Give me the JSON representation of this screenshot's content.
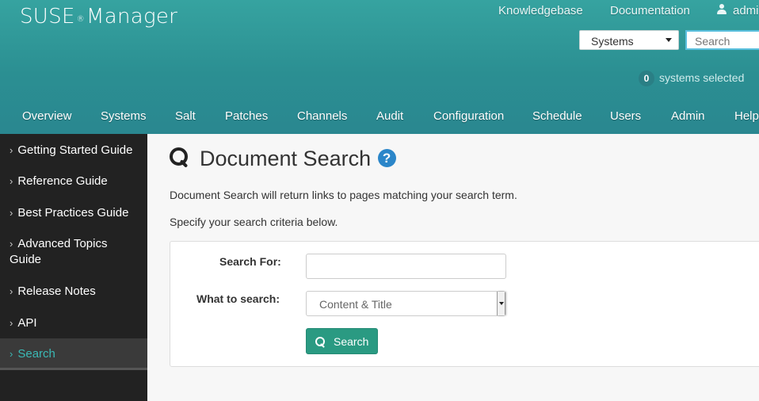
{
  "header": {
    "brand_main": "SUSE",
    "brand_reg": "®",
    "brand_rest": "Manager",
    "links": {
      "knowledgebase": "Knowledgebase",
      "documentation": "Documentation",
      "user": "admi"
    },
    "systems_select": "Systems",
    "search_placeholder": "Search",
    "selected_count": "0",
    "selected_label": "systems selected"
  },
  "nav": {
    "items": [
      "Overview",
      "Systems",
      "Salt",
      "Patches",
      "Channels",
      "Audit",
      "Configuration",
      "Schedule",
      "Users",
      "Admin",
      "Help"
    ]
  },
  "sidebar": {
    "items": [
      {
        "label": "Getting Started Guide"
      },
      {
        "label": "Reference Guide"
      },
      {
        "label": "Best Practices Guide"
      },
      {
        "label_line1": "Advanced Topics",
        "label_line2": "Guide"
      },
      {
        "label": "Release Notes"
      },
      {
        "label": "API"
      },
      {
        "label": "Search",
        "active": true
      }
    ]
  },
  "main": {
    "title": "Document Search",
    "help_symbol": "?",
    "intro": "Document Search will return links to pages matching your search term.",
    "criteria": "Specify your search criteria below.",
    "form": {
      "search_for_label": "Search For:",
      "search_for_value": "",
      "what_label": "What to search:",
      "what_value": "Content & Title",
      "button_label": "Search"
    }
  },
  "colors": {
    "header": "#2b8f92",
    "sidebar": "#222222",
    "accent": "#3bb9b5",
    "button": "#2a9a82",
    "help": "#2b86c9"
  }
}
